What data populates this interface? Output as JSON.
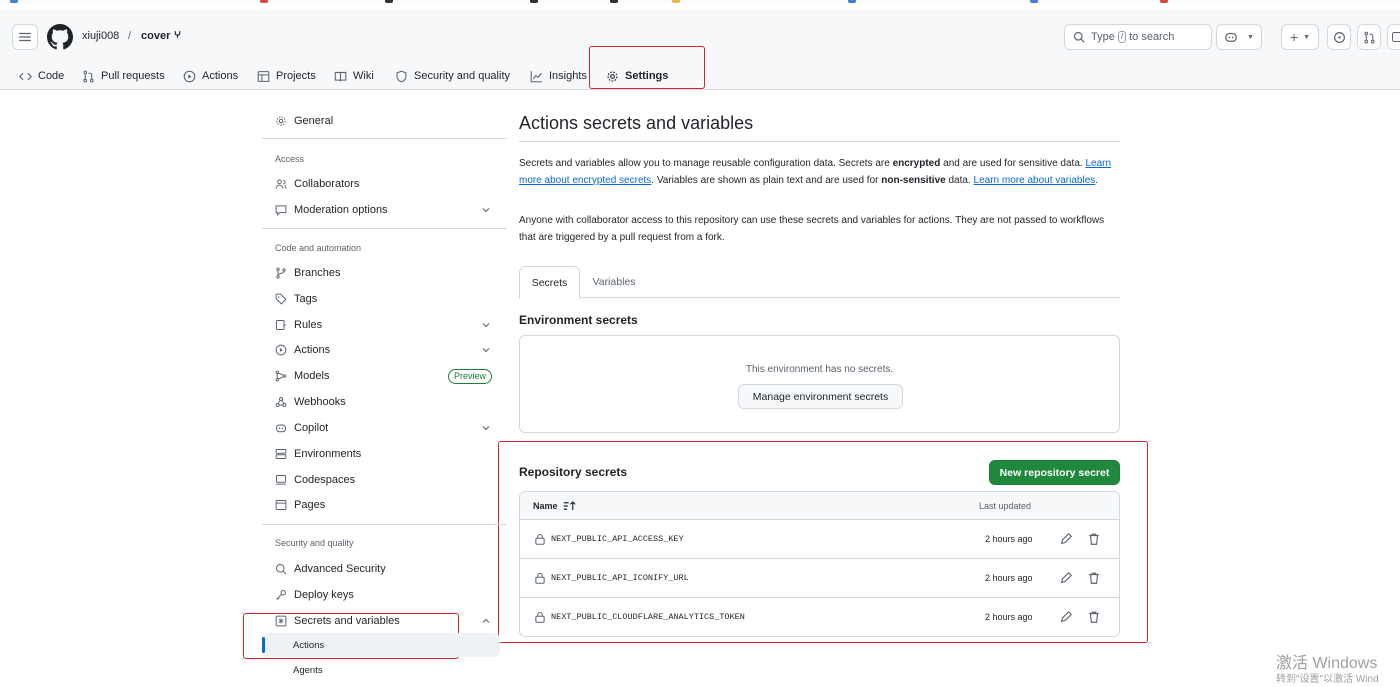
{
  "header": {
    "owner": "xiuji008",
    "separator": "/",
    "repo": "cover",
    "search_prefix": "Type",
    "search_key": "/",
    "search_suffix": "to search"
  },
  "repo_nav": {
    "items": [
      {
        "label": "Code",
        "icon": "code-icon"
      },
      {
        "label": "Pull requests",
        "icon": "pull-request-icon"
      },
      {
        "label": "Actions",
        "icon": "play-icon"
      },
      {
        "label": "Projects",
        "icon": "table-icon"
      },
      {
        "label": "Wiki",
        "icon": "book-icon"
      },
      {
        "label": "Security and quality",
        "icon": "shield-icon"
      },
      {
        "label": "Insights",
        "icon": "graph-icon"
      },
      {
        "label": "Settings",
        "icon": "gear-icon",
        "active": true
      }
    ]
  },
  "sidebar": {
    "general": "General",
    "access_heading": "Access",
    "collaborators": "Collaborators",
    "moderation": "Moderation options",
    "code_heading": "Code and automation",
    "branches": "Branches",
    "tags": "Tags",
    "rules": "Rules",
    "actions": "Actions",
    "models": "Models",
    "preview_badge": "Preview",
    "webhooks": "Webhooks",
    "copilot": "Copilot",
    "environments": "Environments",
    "codespaces": "Codespaces",
    "pages": "Pages",
    "security_heading": "Security and quality",
    "advanced_security": "Advanced Security",
    "deploy_keys": "Deploy keys",
    "secrets_variables": "Secrets and variables",
    "sub_actions": "Actions",
    "sub_agents": "Agents"
  },
  "main": {
    "title": "Actions secrets and variables",
    "desc1_a": "Secrets and variables allow you to manage reusable configuration data. Secrets are ",
    "desc1_b": "encrypted",
    "desc1_c": " and are used for sensitive data. ",
    "desc1_link1": "Learn more about encrypted secrets",
    "desc1_d": ". Variables are shown as plain text and are used for ",
    "desc1_e": "non-sensitive",
    "desc1_f": " data. ",
    "desc1_link2": "Learn more about variables",
    "desc1_g": ".",
    "desc2": "Anyone with collaborator access to this repository can use these secrets and variables for actions. They are not passed to workflows that are triggered by a pull request from a fork.",
    "tabs": [
      "Secrets",
      "Variables"
    ],
    "env_heading": "Environment secrets",
    "env_empty": "This environment has no secrets.",
    "env_button": "Manage environment secrets",
    "repo_heading": "Repository secrets",
    "new_secret_button": "New repository secret",
    "col_name": "Name",
    "col_updated": "Last updated",
    "secrets": [
      {
        "name": "NEXT_PUBLIC_API_ACCESS_KEY",
        "updated": "2 hours ago"
      },
      {
        "name": "NEXT_PUBLIC_API_ICONIFY_URL",
        "updated": "2 hours ago"
      },
      {
        "name": "NEXT_PUBLIC_CLOUDFLARE_ANALYTICS_TOKEN",
        "updated": "2 hours ago"
      }
    ]
  },
  "overlay": {
    "watermark": "激活 Windows",
    "watermark_sub": "转到\"设置\"以激活 Wind"
  },
  "colors": {
    "accent": "#0969da",
    "primary_button": "#1f883d",
    "highlight_box": "#d1242f"
  }
}
